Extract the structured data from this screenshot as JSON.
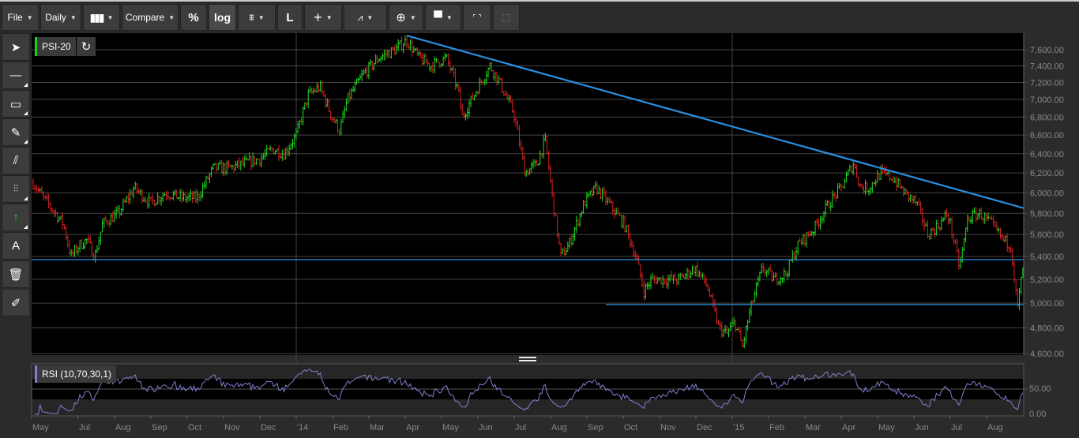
{
  "toolbar": {
    "file": "File",
    "period": "Daily",
    "compare": "Compare",
    "percent": "%",
    "log": "log",
    "linear": "L"
  },
  "symbol": {
    "name": "PSI-20",
    "color": "#22cc22"
  },
  "indicator": {
    "label": "RSI (10,70,30,1)",
    "color": "#8080d0",
    "axis": [
      "50.00",
      "0.00"
    ]
  },
  "colors": {
    "up": "#22dd22",
    "down": "#dd2222",
    "trend": "#2a8fe0"
  },
  "chart_data": {
    "type": "ohlc",
    "scale": "log",
    "ylim": [
      4600,
      7600
    ],
    "yticks": [
      7600,
      7400,
      7200,
      7000,
      6800,
      6600,
      6400,
      6200,
      6000,
      5800,
      5600,
      5400,
      5200,
      5000,
      4800,
      4600
    ],
    "ytick_labels": [
      "7,600.00",
      "7,400.00",
      "7,200.00",
      "7,000.00",
      "6,800.00",
      "6,600.00",
      "6,400.00",
      "6,200.00",
      "6,000.00",
      "5,800.00",
      "5,600.00",
      "5,400.00",
      "5,200.00",
      "5,000.00",
      "4,800.00",
      "4,600.00"
    ],
    "xlabels": [
      [
        "May",
        0
      ],
      [
        "Jul",
        2
      ],
      [
        "Aug",
        3
      ],
      [
        "Sep",
        4
      ],
      [
        "Oct",
        5
      ],
      [
        "Nov",
        6
      ],
      [
        "Dec",
        7
      ],
      [
        "'14",
        8
      ],
      [
        "Feb",
        9
      ],
      [
        "Mar",
        10
      ],
      [
        "Apr",
        11
      ],
      [
        "May",
        12
      ],
      [
        "Jun",
        13
      ],
      [
        "Jul",
        14
      ],
      [
        "Aug",
        15
      ],
      [
        "Sep",
        16
      ],
      [
        "Oct",
        17
      ],
      [
        "Nov",
        18
      ],
      [
        "Dec",
        19
      ],
      [
        "'15",
        20
      ],
      [
        "Feb",
        21
      ],
      [
        "Mar",
        22
      ],
      [
        "Apr",
        23
      ],
      [
        "May",
        24
      ],
      [
        "Jun",
        25
      ],
      [
        "Jul",
        26
      ],
      [
        "Aug",
        27
      ]
    ],
    "x_unit": "months since May 2013",
    "price_path": [
      [
        0.76,
        6100
      ],
      [
        1.04,
        5950
      ],
      [
        1.37,
        5800
      ],
      [
        1.59,
        5700
      ],
      [
        1.8,
        5400
      ],
      [
        2.02,
        5500
      ],
      [
        2.24,
        5550
      ],
      [
        2.46,
        5400
      ],
      [
        2.67,
        5700
      ],
      [
        3.11,
        5800
      ],
      [
        3.54,
        6050
      ],
      [
        3.98,
        5900
      ],
      [
        4.41,
        6000
      ],
      [
        4.85,
        5950
      ],
      [
        5.28,
        5950
      ],
      [
        5.72,
        6250
      ],
      [
        6.15,
        6250
      ],
      [
        6.59,
        6300
      ],
      [
        7.02,
        6350
      ],
      [
        7.35,
        6450
      ],
      [
        7.67,
        6400
      ],
      [
        8.0,
        6600
      ],
      [
        8.33,
        7050
      ],
      [
        8.65,
        7150
      ],
      [
        8.98,
        6800
      ],
      [
        9.2,
        6650
      ],
      [
        9.41,
        7000
      ],
      [
        9.85,
        7300
      ],
      [
        10.28,
        7500
      ],
      [
        10.72,
        7600
      ],
      [
        11.04,
        7720
      ],
      [
        11.37,
        7500
      ],
      [
        11.7,
        7400
      ],
      [
        12.13,
        7500
      ],
      [
        12.46,
        7100
      ],
      [
        12.57,
        6800
      ],
      [
        12.89,
        7050
      ],
      [
        13.33,
        7400
      ],
      [
        13.54,
        7250
      ],
      [
        13.98,
        6850
      ],
      [
        14.3,
        6200
      ],
      [
        14.63,
        6300
      ],
      [
        14.85,
        6550
      ],
      [
        15.07,
        5900
      ],
      [
        15.28,
        5400
      ],
      [
        15.5,
        5500
      ],
      [
        15.93,
        5900
      ],
      [
        16.26,
        6050
      ],
      [
        16.59,
        5900
      ],
      [
        17.02,
        5700
      ],
      [
        17.35,
        5400
      ],
      [
        17.57,
        5100
      ],
      [
        17.78,
        5200
      ],
      [
        18.11,
        5200
      ],
      [
        18.54,
        5200
      ],
      [
        18.98,
        5300
      ],
      [
        19.3,
        5150
      ],
      [
        19.63,
        4800
      ],
      [
        19.85,
        4750
      ],
      [
        20.07,
        4850
      ],
      [
        20.28,
        4650
      ],
      [
        20.5,
        4950
      ],
      [
        20.83,
        5300
      ],
      [
        21.15,
        5200
      ],
      [
        21.48,
        5250
      ],
      [
        21.8,
        5500
      ],
      [
        22.24,
        5650
      ],
      [
        22.67,
        5900
      ],
      [
        23.0,
        6050
      ],
      [
        23.33,
        6300
      ],
      [
        23.54,
        6050
      ],
      [
        23.76,
        6050
      ],
      [
        24.09,
        6200
      ],
      [
        24.41,
        6150
      ],
      [
        24.74,
        6000
      ],
      [
        25.07,
        5900
      ],
      [
        25.39,
        5600
      ],
      [
        25.72,
        5700
      ],
      [
        25.93,
        5800
      ],
      [
        26.26,
        5300
      ],
      [
        26.48,
        5750
      ],
      [
        26.8,
        5800
      ],
      [
        27.13,
        5700
      ],
      [
        27.46,
        5550
      ],
      [
        27.67,
        5500
      ],
      [
        27.85,
        4950
      ],
      [
        28.0,
        5300
      ]
    ],
    "trendlines": [
      {
        "from": [
          11.04,
          7780
        ],
        "to": [
          28.02,
          5850
        ]
      }
    ],
    "hlines": [
      {
        "price": 5372,
        "from": 0.7
      },
      {
        "price": 4988,
        "from": 16.52
      }
    ]
  }
}
